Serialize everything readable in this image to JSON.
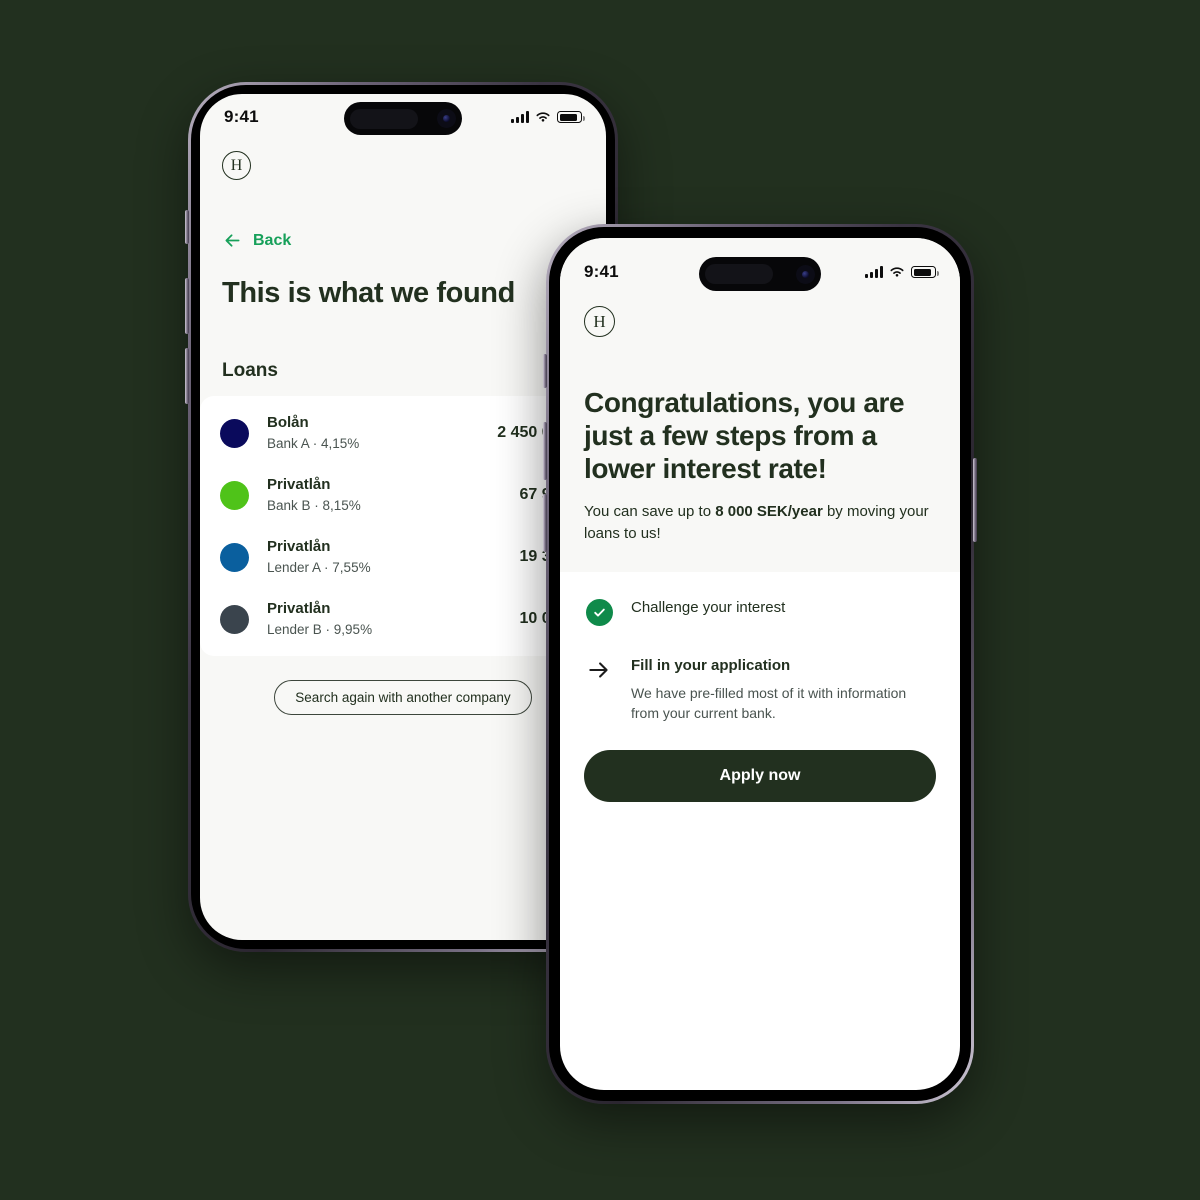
{
  "background_color": "#22301f",
  "brand": {
    "logo_letter": "H",
    "accent_green": "#17a05a",
    "dark_green": "#22301f"
  },
  "phone1": {
    "status_bar": {
      "time": "9:41",
      "signal": "signal-bars",
      "wifi": "wifi",
      "battery": "battery-full"
    },
    "back_label": "Back",
    "title": "This is what we found",
    "section_label": "Loans",
    "loans": [
      {
        "type": "Bolån",
        "lender": "Bank A",
        "rate": "4,15%",
        "detail": "Bank A · 4,15%",
        "amount": "2 450 000 kr",
        "color": "#0a0a5c"
      },
      {
        "type": "Privatlån",
        "lender": "Bank B",
        "rate": "8,15%",
        "detail": "Bank B · 8,15%",
        "amount": "67 950 kr",
        "color": "#4fc319"
      },
      {
        "type": "Privatlån",
        "lender": "Lender A",
        "rate": "7,55%",
        "detail": "Lender A ·  7,55%",
        "amount": "19 380 kr",
        "color": "#0a5f9e"
      },
      {
        "type": "Privatlån",
        "lender": "Lender B",
        "rate": "9,95%",
        "detail": "Lender B ·  9,95%",
        "amount": "10 000 kr",
        "color": "#3a444d"
      }
    ],
    "search_again_label": "Search again with another company"
  },
  "phone2": {
    "status_bar": {
      "time": "9:41",
      "signal": "signal-bars",
      "wifi": "wifi",
      "battery": "battery-full"
    },
    "title": "Congratulations, you are just a few steps from a lower interest rate!",
    "subtitle_pre": "You can save up to ",
    "subtitle_bold": "8 000 SEK/year",
    "subtitle_post": " by moving your loans to us!",
    "steps": [
      {
        "icon": "check-circle-icon",
        "title": "Challenge your interest",
        "desc": ""
      },
      {
        "icon": "arrow-right-icon",
        "title": "Fill in your application",
        "desc": "We have pre-filled most of it with information from your current bank."
      }
    ],
    "apply_label": "Apply now"
  }
}
